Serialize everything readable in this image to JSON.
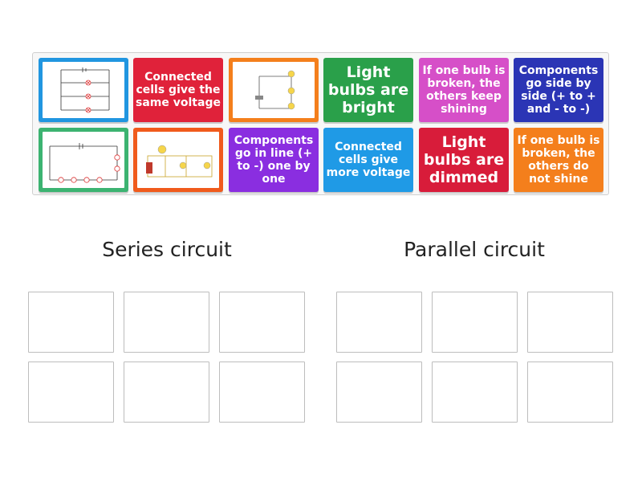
{
  "cards": [
    {
      "id": "parallel-diagram-card",
      "type": "image",
      "color": "#2196e0",
      "image": "parallel-circuit-diagram"
    },
    {
      "id": "same-voltage-card",
      "type": "text",
      "color": "#e0223a",
      "size": "md",
      "text": "Connected cells give the same voltage"
    },
    {
      "id": "series-photo-card",
      "type": "image",
      "color": "#f47f1c",
      "image": "series-circuit-bulbs-illustration"
    },
    {
      "id": "bright-card",
      "type": "text",
      "color": "#2aa04a",
      "size": "lg",
      "text": "Light bulbs are bright"
    },
    {
      "id": "keep-shining-card",
      "type": "text",
      "color": "#d64fc8",
      "size": "md",
      "text": "If one bulb is broken, the others keep shining"
    },
    {
      "id": "side-by-side-card",
      "type": "text",
      "color": "#2b35b5",
      "size": "md",
      "text": "Components go side by side (+ to + and - to -)"
    },
    {
      "id": "series-diagram-card",
      "type": "image",
      "color": "#3cb371",
      "image": "series-circuit-diagram"
    },
    {
      "id": "parallel-photo-card",
      "type": "image",
      "color": "#f05a1c",
      "image": "parallel-circuit-bulbs-illustration"
    },
    {
      "id": "in-line-card",
      "type": "text",
      "color": "#8a2ee0",
      "size": "md",
      "text": "Components go in line (+ to -) one by one"
    },
    {
      "id": "more-voltage-card",
      "type": "text",
      "color": "#1f9ae6",
      "size": "md",
      "text": "Connected cells give more voltage"
    },
    {
      "id": "dimmed-card",
      "type": "text",
      "color": "#d81c3a",
      "size": "lg",
      "text": "Light bulbs are dimmed"
    },
    {
      "id": "not-shine-card",
      "type": "text",
      "color": "#f47f1c",
      "size": "md",
      "text": "If one bulb is broken, the others do not shine"
    }
  ],
  "groups": {
    "series": {
      "title": "Series circuit"
    },
    "parallel": {
      "title": "Parallel circuit"
    }
  }
}
